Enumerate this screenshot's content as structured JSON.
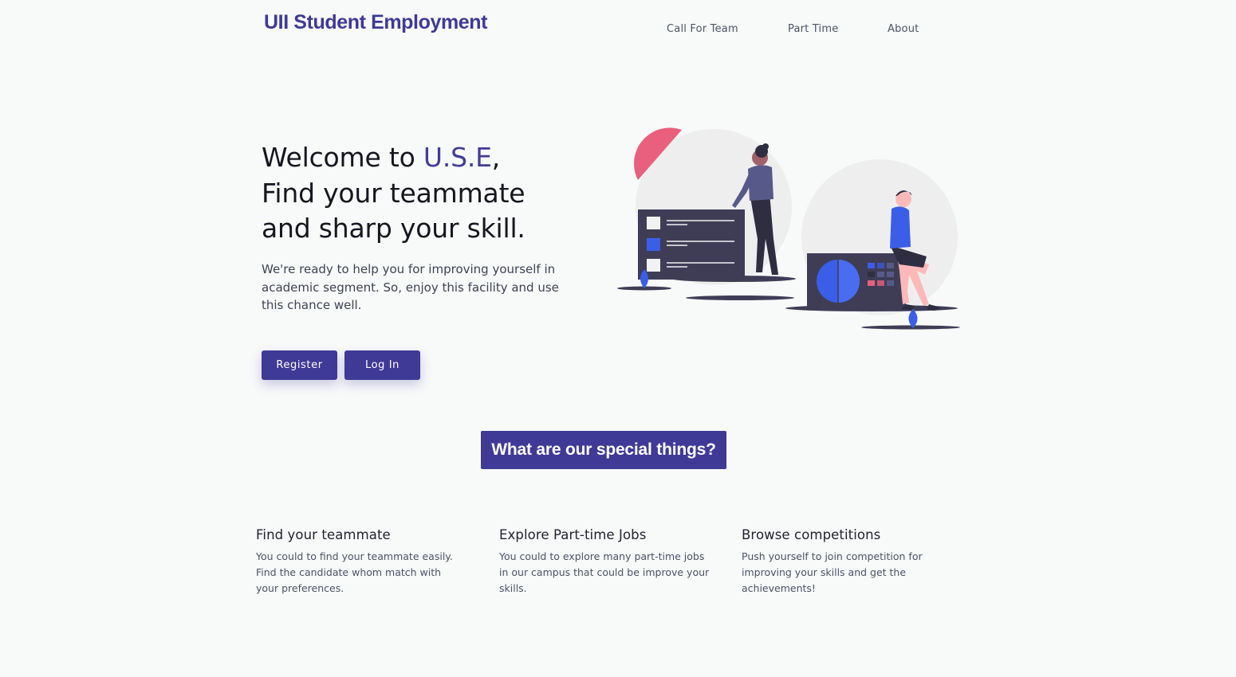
{
  "brand": "UII Student Employment",
  "nav": [
    {
      "label": "Call For Team"
    },
    {
      "label": "Part Time"
    },
    {
      "label": "About"
    }
  ],
  "hero": {
    "title_prefix": "Welcome to ",
    "title_accent": "U.S.E",
    "title_comma": ",",
    "title_line2": "Find your teammate",
    "title_line3": "and sharp your skill.",
    "description": "We're ready to help you for improving yourself in academic segment. So, enjoy this facility and use this chance well.",
    "register_label": "Register",
    "login_label": "Log In"
  },
  "section": {
    "heading": "What are our special things?"
  },
  "features": [
    {
      "title": "Find your teammate",
      "text": "You could to find your teammate easily. Find the candidate whom match with your preferences."
    },
    {
      "title": "Explore Part-time Jobs",
      "text": "You could to explore many part-time jobs in our campus that could be improve your skills."
    },
    {
      "title": "Browse competitions",
      "text": "Push yourself to join competition for improving your skills and get the achievements!"
    }
  ],
  "colors": {
    "primary": "#3f3a96",
    "accent_pink": "#e8607d",
    "accent_blue": "#3b5ee8",
    "dark": "#3f3d56",
    "background": "#f8f9f9"
  }
}
